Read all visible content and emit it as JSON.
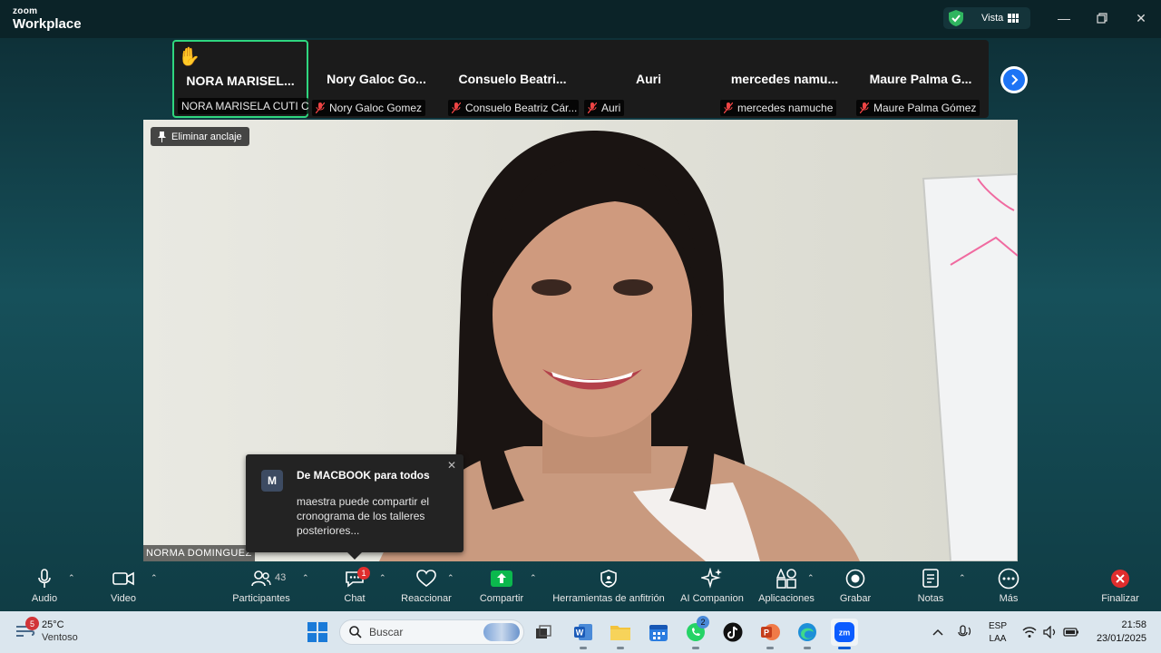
{
  "app": {
    "brand_small": "zoom",
    "brand_large": "Workplace"
  },
  "titlebar": {
    "view_label": "Vista"
  },
  "participants": [
    {
      "name": "NORA MARISEL...",
      "label": "NORA MARISELA CUTI C...",
      "hand_raised": true,
      "active": true
    },
    {
      "name": "Nory Galoc Go...",
      "label": "Nory Galoc Gomez",
      "muted": true
    },
    {
      "name": "Consuelo Beatri...",
      "label": "Consuelo Beatriz Cár...",
      "muted": true
    },
    {
      "name": "Auri",
      "label": "Auri",
      "muted": true
    },
    {
      "name": "mercedes namu...",
      "label": "mercedes namuche",
      "muted": true
    },
    {
      "name": "Maure Palma G...",
      "label": "Maure Palma Gómez",
      "muted": true
    }
  ],
  "video": {
    "unpin_label": "Eliminar anclaje",
    "speaker_name": "NORMA DOMINGUEZ"
  },
  "chat_toast": {
    "avatar": "M",
    "from": "De MACBOOK para todos",
    "message": "maestra puede compartir el cronograma de los talleres posteriores..."
  },
  "toolbar": {
    "audio": "Audio",
    "video": "Video",
    "participants": "Participantes",
    "participants_count": "43",
    "chat": "Chat",
    "chat_badge": "1",
    "react": "Reaccionar",
    "share": "Compartir",
    "host_tools": "Herramientas de anfitrión",
    "ai": "AI Companion",
    "apps": "Aplicaciones",
    "record": "Grabar",
    "notes": "Notas",
    "more": "Más",
    "end": "Finalizar"
  },
  "taskbar": {
    "weather_temp": "25°C",
    "weather_desc": "Ventoso",
    "weather_badge": "5",
    "search_placeholder": "Buscar",
    "whatsapp_badge": "2",
    "lang_1": "ESP",
    "lang_2": "LAA",
    "time": "21:58",
    "date": "23/01/2025"
  },
  "colors": {
    "accent_green": "#2fd67f",
    "share_green": "#0bb84d",
    "zoom_blue": "#1d74f5",
    "end_red": "#e02d2d"
  }
}
